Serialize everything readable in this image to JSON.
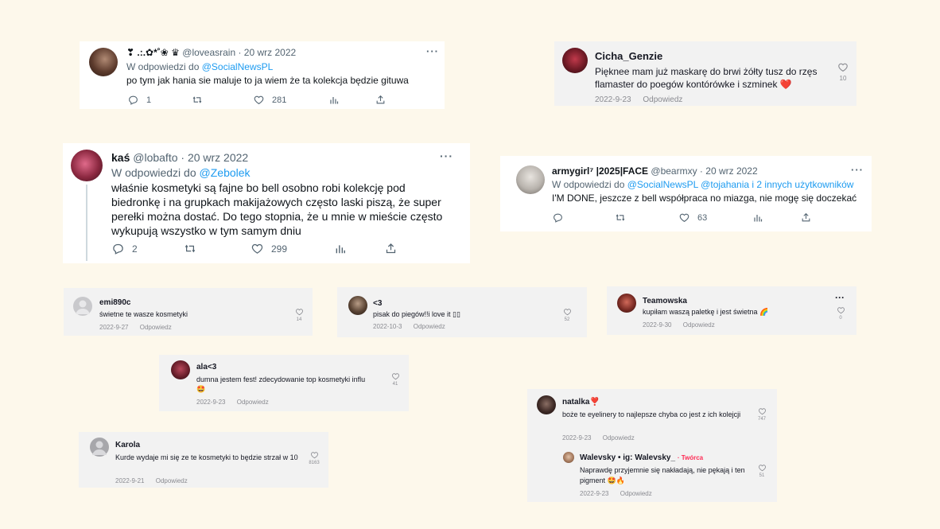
{
  "tweet1": {
    "name": "❣ .:.✿*˚❀ ♛",
    "handle_date": "@loveasrain · 20 wrz 2022",
    "reply_prefix": "W odpowiedzi do",
    "reply_to": "@SocialNewsPL",
    "text": "po tym jak hania sie maluje to ja wiem że ta kolekcja będzie gituwa",
    "more": "···",
    "replies": "1",
    "likes": "281"
  },
  "tweet2": {
    "name": "kaś",
    "handle_date": "@lobafto · 20 wrz 2022",
    "reply_prefix": "W odpowiedzi do",
    "reply_to": "@Zebolek",
    "text": "właśnie kosmetyki są fajne bo bell osobno robi kolekcję pod biedronkę i na grupkach makijażowych często laski piszą, że super perełki można dostać. Do tego stopnia, że u mnie w mieście często wykupują wszystko w tym samym dniu",
    "more": "···",
    "replies": "2",
    "likes": "299"
  },
  "tweet3": {
    "name": "armygirl⁷ |2025|FACE",
    "handle_date": "@bearmxy · 20 wrz 2022",
    "reply_prefix": "W odpowiedzi do",
    "reply_to": "@SocialNewsPL @tojahania",
    "reply_others": "i 2 innych użytkowników",
    "text": "I'M DONE, jeszcze z bell współpraca no miazga, nie mogę się doczekać",
    "more": "···",
    "likes": "63"
  },
  "cicha": {
    "username": "Cicha_Genzie",
    "text": "Pięknee mam już maskarę do brwi żółty tusz do rzęs flamaster do poegów kontórówke i szminek",
    "emoji": "❤️",
    "date": "2022-9-23",
    "reply": "Odpowiedz",
    "likes": "10"
  },
  "emi": {
    "username": "emi890c",
    "text": "świetne te wasze kosmetyki",
    "date": "2022-9-27",
    "reply": "Odpowiedz",
    "likes": "14"
  },
  "lt3": {
    "username": "<3",
    "text": "pisak do piegów!!i love it ▯▯",
    "date": "2022-10-3",
    "reply": "Odpowiedz",
    "likes": "52"
  },
  "teamowska": {
    "username": "Teamowska",
    "text": "kupiłam waszą paletkę i jest świetna 🌈",
    "date": "2022-9-30",
    "reply": "Odpowiedz",
    "more": "···",
    "likes": "0"
  },
  "ala": {
    "username": "ala<3",
    "text": "dumna jestem fest! zdecydowanie top kosmetyki influ",
    "emoji": "🤩",
    "date": "2022-9-23",
    "reply": "Odpowiedz",
    "likes": "41"
  },
  "karola": {
    "username": "Karola",
    "text": "Kurde wydaje mi się ze te kosmetyki to będzie strzał w 10",
    "date": "2022-9-21",
    "reply": "Odpowiedz",
    "likes": "8163"
  },
  "natalka": {
    "username": "natalka",
    "user_emoji": "❣️",
    "text": "boże te eyelinerу to najlepsze chyba co jest z ich kolejcji",
    "date": "2022-9-23",
    "reply": "Odpowiedz",
    "likes": "747"
  },
  "walevsky": {
    "username": "Walevsky • ig: Walevsky_",
    "creator": "· Twórca",
    "text": "Naprawdę przyjemnie się nakładają, nie pękają i ten pigment",
    "emoji": "🤩🔥",
    "date": "2022-9-23",
    "reply": "Odpowiedz",
    "likes": "51"
  },
  "colors": {
    "background": "#fdf8eb",
    "link": "#1d9bf0",
    "creator": "#fe2c55"
  },
  "icons": [
    "reply-icon",
    "retweet-icon",
    "like-icon",
    "views-icon",
    "share-icon",
    "heart-outline-icon"
  ]
}
